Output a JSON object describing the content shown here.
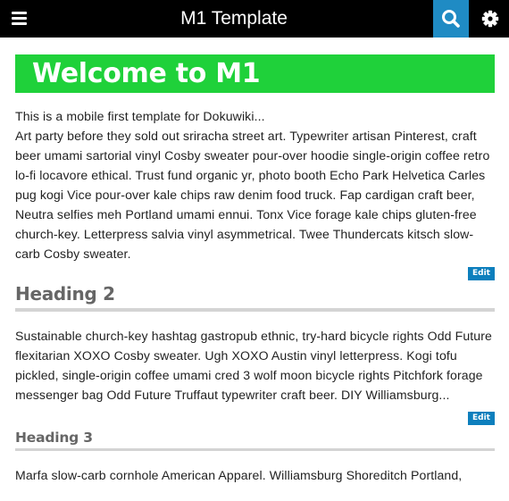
{
  "header": {
    "title": "M1 Template",
    "menu_icon": "hamburger-menu-icon",
    "search_icon": "search-icon",
    "settings_icon": "gear-icon",
    "search_bg": "#1f8bc4"
  },
  "page": {
    "title": "Welcome to M1",
    "title_bg": "#1fd13a",
    "intro": "This is a mobile first template for Dokuwiki...",
    "paragraph1": "Art party before they sold out sriracha street art. Typewriter artisan Pinterest, craft beer umami sartorial vinyl Cosby sweater pour-over hoodie single-origin coffee retro lo-fi locavore ethical. Trust fund organic yr, photo booth Echo Park Helvetica Carles pug kogi Vice pour-over kale chips raw denim food truck. Fap cardigan craft beer, Neutra selfies meh Portland umami ennui. Tonx Vice forage kale chips gluten-free church-key. Letterpress salvia vinyl asymmetrical. Twee Thundercats kitsch slow-carb Cosby sweater.",
    "edit_label": "Edit",
    "heading2": "Heading 2",
    "paragraph2": "Sustainable church-key hashtag gastropub ethnic, try-hard bicycle rights Odd Future flexitarian XOXO Cosby sweater. Ugh XOXO Austin vinyl letterpress. Kogi tofu pickled, single-origin coffee umami cred 3 wolf moon bicycle rights Pitchfork forage messenger bag Odd Future Truffaut typewriter craft beer. DIY Williamsburg...",
    "heading3": "Heading 3",
    "paragraph3": "Marfa slow-carb cornhole American Apparel. Williamsburg Shoreditch Portland,"
  }
}
